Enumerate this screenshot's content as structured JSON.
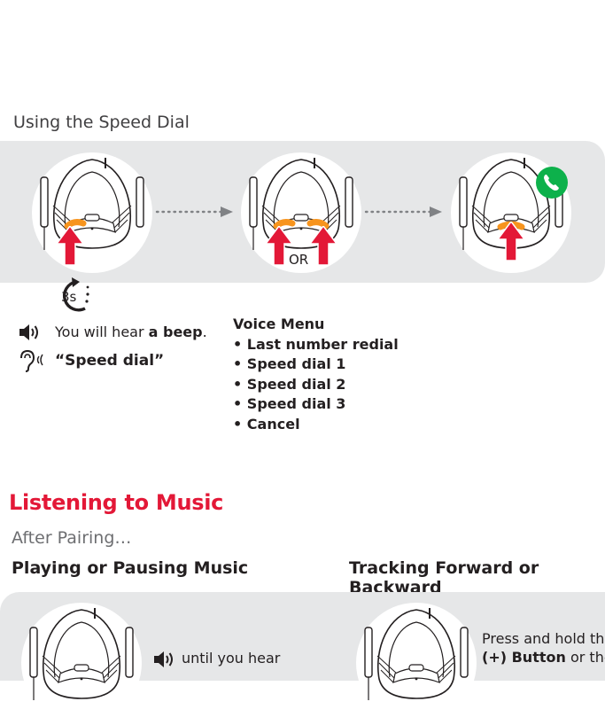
{
  "speed_dial": {
    "title": "Using the Speed Dial",
    "or_label": "OR",
    "hold_time": "3s",
    "beep_text_prefix": "You will hear ",
    "beep_text_bold": "a beep",
    "beep_text_suffix": ".",
    "voice_prompt": "“Speed dial”",
    "voice_menu": {
      "heading": "Voice Menu",
      "items": [
        "• Last number redial",
        "• Speed dial 1",
        "• Speed dial 2",
        "• Speed dial 3",
        "• Cancel"
      ]
    }
  },
  "music": {
    "title": "Listening to Music",
    "subtitle": "After Pairing…",
    "play_pause_heading": "Playing or Pausing Music",
    "tracking_heading": "Tracking Forward or Backward",
    "hear_text": "until you hear",
    "press_hold_text": "Press and hold the",
    "plus_button_bold": "(+) Button",
    "plus_button_suffix": " or the"
  },
  "colors": {
    "accent_red": "#e31837",
    "button_orange": "#f7941d",
    "call_green": "#0db14b",
    "band_gray": "#e6e7e8"
  }
}
